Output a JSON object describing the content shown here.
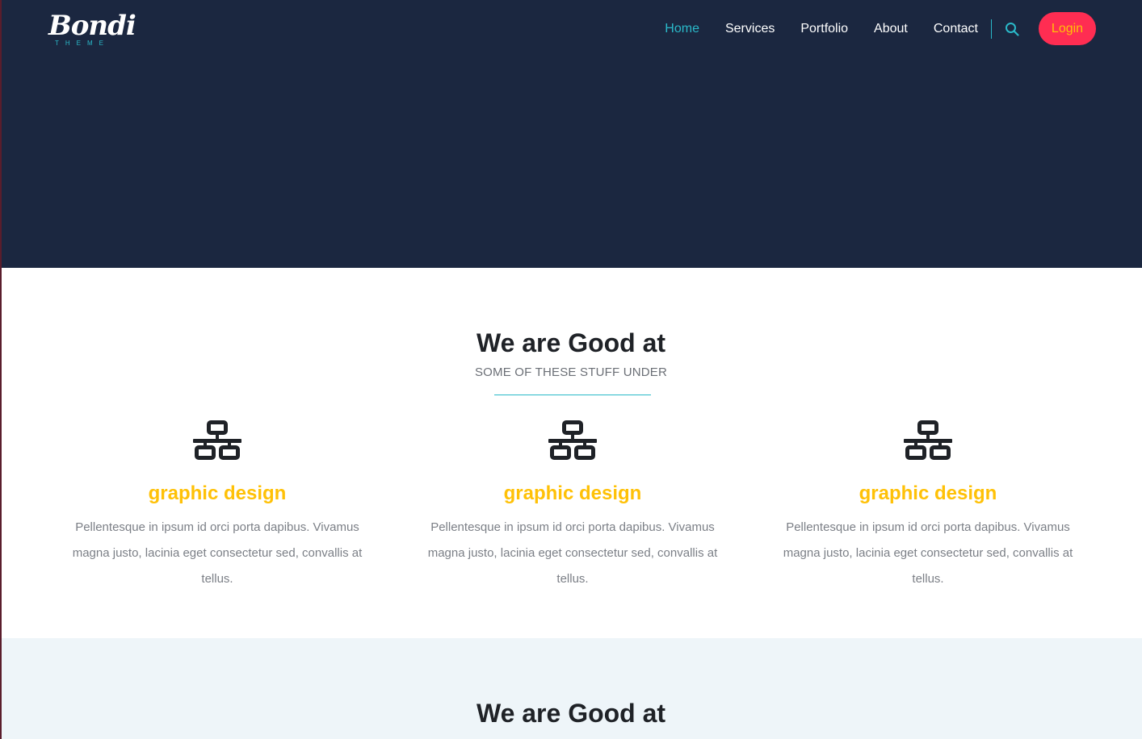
{
  "header": {
    "logo": {
      "text": "Bondi",
      "subtext": "THEME"
    },
    "nav": [
      {
        "label": "Home",
        "active": true
      },
      {
        "label": "Services",
        "active": false
      },
      {
        "label": "Portfolio",
        "active": false
      },
      {
        "label": "About",
        "active": false
      },
      {
        "label": "Contact",
        "active": false
      }
    ],
    "search_icon": "search-icon",
    "login_label": "Login"
  },
  "services_section": {
    "title": "We are Good at",
    "subtitle": "SOME OF THESE STUFF UNDER",
    "items": [
      {
        "icon": "network-icon",
        "title": "graphic design",
        "text": "Pellentesque in ipsum id orci porta dapibus. Vivamus magna justo, lacinia eget consectetur sed, convallis at tellus."
      },
      {
        "icon": "network-icon",
        "title": "graphic design",
        "text": "Pellentesque in ipsum id orci porta dapibus. Vivamus magna justo, lacinia eget consectetur sed, convallis at tellus."
      },
      {
        "icon": "network-icon",
        "title": "graphic design",
        "text": "Pellentesque in ipsum id orci porta dapibus. Vivamus magna justo, lacinia eget consectetur sed, convallis at tellus."
      }
    ]
  },
  "second_section": {
    "title": "We are Good at"
  },
  "colors": {
    "hero_bg": "#1b2740",
    "accent": "#2ab9c9",
    "login_bg": "#ff2d52",
    "highlight": "#ffc107",
    "section_alt_bg": "#eef5f9"
  }
}
